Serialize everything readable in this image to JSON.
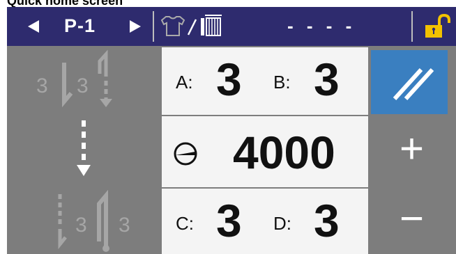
{
  "caption": "Quick home screen",
  "topbar": {
    "pattern_label": "P-1",
    "status_text": "- - - -",
    "icons": {
      "prev": "left-arrow-icon",
      "next": "right-arrow-icon",
      "mode": "garment-thread-icon",
      "lock": "unlocked-padlock-icon"
    }
  },
  "stitch": {
    "a_label": "A:",
    "a_value": "3",
    "b_label": "B:",
    "b_value": "3",
    "c_label": "C:",
    "c_value": "3",
    "d_label": "D:",
    "d_value": "3",
    "speed_value": "4000"
  },
  "left_buttons": {
    "top_icon_digits": [
      "3",
      "3"
    ],
    "bottom_icon_digits": [
      "3",
      "3"
    ]
  },
  "right_buttons": {
    "plus": "+",
    "minus": "−"
  },
  "colors": {
    "topbar": "#2e2b6e",
    "panel_gray": "#7d7d7d",
    "cell_bg": "#f4f4f4",
    "active_button": "#3a7fc0",
    "lock": "#f2c200"
  }
}
